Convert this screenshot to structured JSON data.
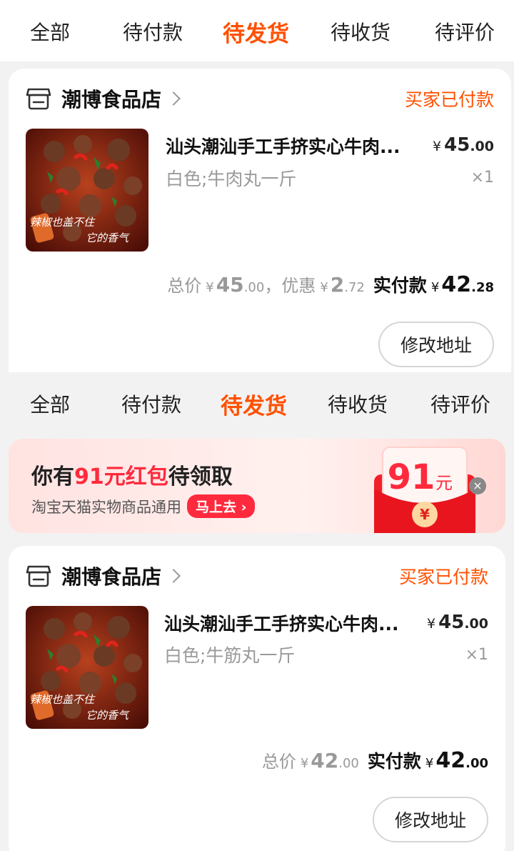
{
  "tabs_top": [
    "全部",
    "待付款",
    "待发货",
    "待收货",
    "待评价"
  ],
  "tabs_mid": [
    "全部",
    "待付款",
    "待发货",
    "待收货",
    "待评价"
  ],
  "active_tab": "待发货",
  "order1": {
    "shop_name": "潮博食品店",
    "status": "买家已付款",
    "image_caption_line1": "辣椒也盖不住",
    "image_caption_line2": "它的香气",
    "title": "汕头潮汕手工手挤实心牛肉...",
    "sku": "白色;牛肉丸一斤",
    "price_symbol": "¥",
    "price_int": "45",
    "price_dec": ".00",
    "qty": "×1",
    "total_label": "总价",
    "total_int": "45",
    "total_dec": ".00",
    "comma": "，",
    "discount_label": "优惠",
    "discount_int": "2",
    "discount_dec": ".72",
    "paid_label": "实付款",
    "paid_int": "42",
    "paid_dec": ".28",
    "button": "修改地址"
  },
  "banner": {
    "title_pre": "你有",
    "title_hl": "91元红包",
    "title_post": "待领取",
    "subtitle": "淘宝天猫实物商品通用",
    "go_button": "马上去",
    "go_arrow": "›",
    "amount": "91",
    "unit": "元",
    "envelope_symbol": "¥",
    "close": "×"
  },
  "order2": {
    "shop_name": "潮博食品店",
    "status": "买家已付款",
    "image_caption_line1": "辣椒也盖不住",
    "image_caption_line2": "它的香气",
    "title": "汕头潮汕手工手挤实心牛肉...",
    "sku": "白色;牛筋丸一斤",
    "price_symbol": "¥",
    "price_int": "45",
    "price_dec": ".00",
    "qty": "×1",
    "total_label": "总价",
    "total_int": "42",
    "total_dec": ".00",
    "paid_label": "实付款",
    "paid_int": "42",
    "paid_dec": ".00",
    "button": "修改地址"
  },
  "colors": {
    "accent": "#ff5000",
    "red": "#ff2a3d",
    "muted": "#999999"
  }
}
